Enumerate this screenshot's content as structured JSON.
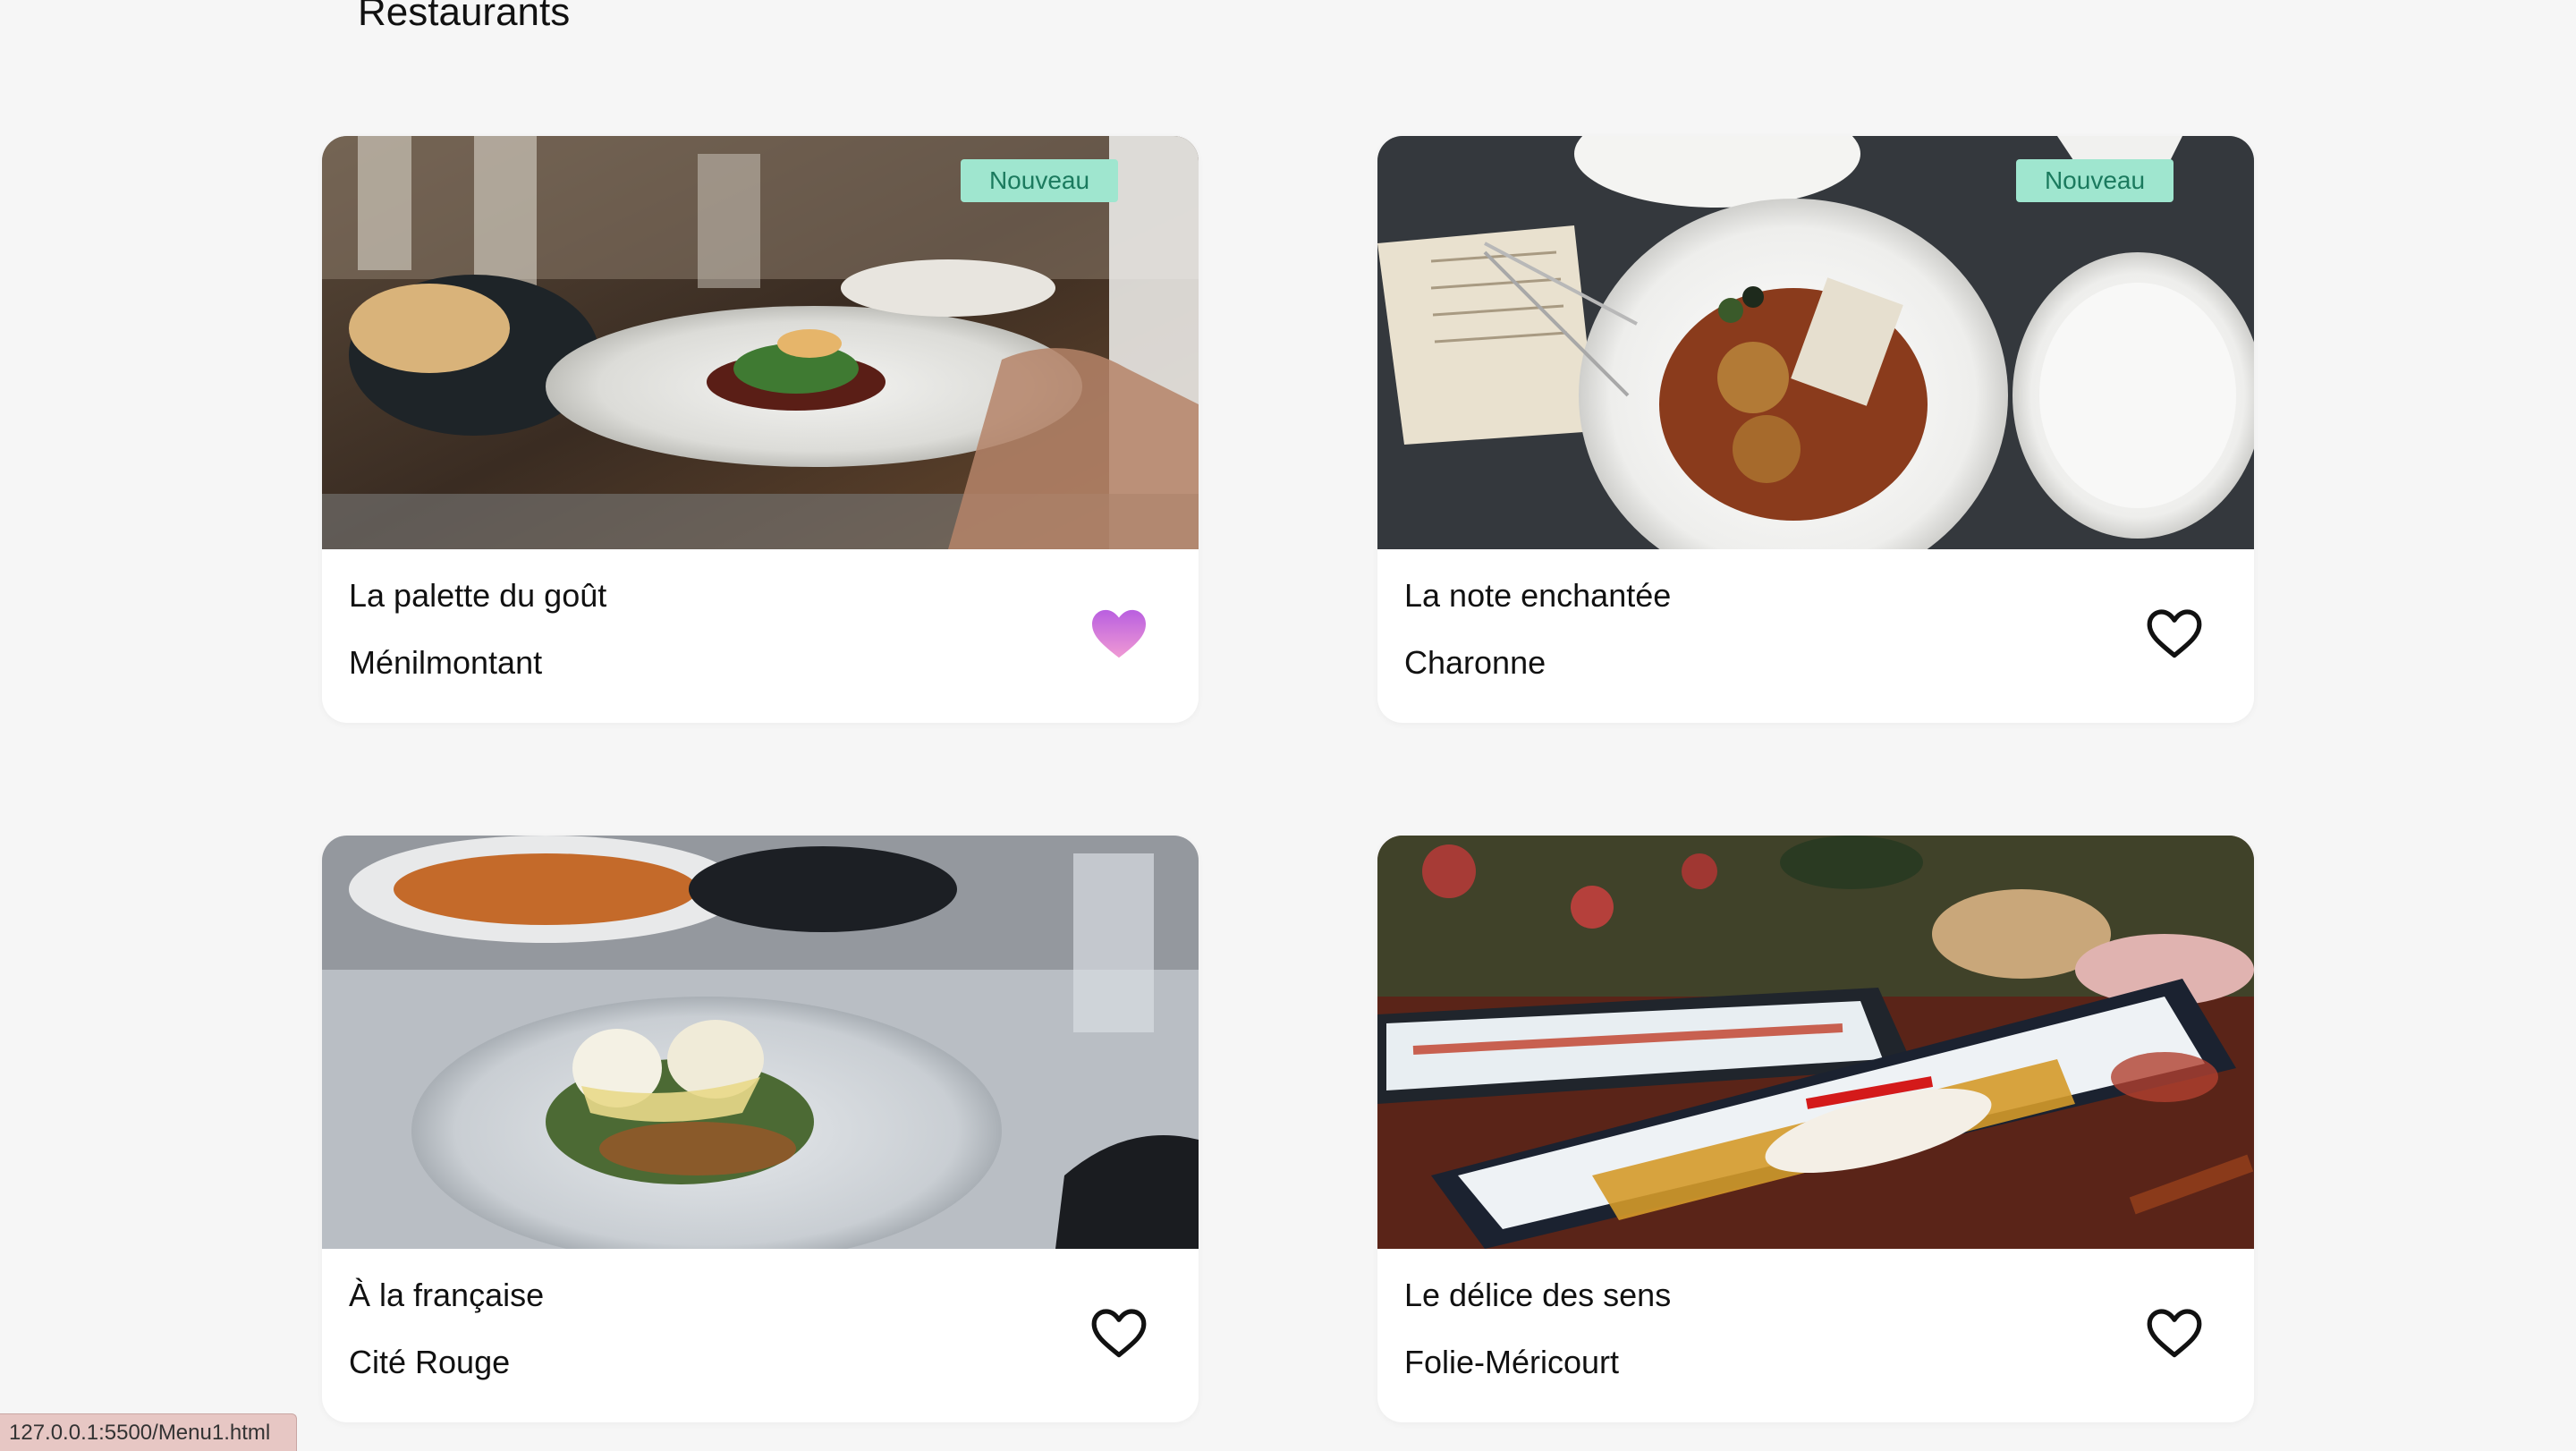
{
  "page": {
    "title": "Restaurants"
  },
  "restaurants": [
    {
      "name": "La palette du goût",
      "area": "Ménilmontant",
      "badge": "Nouveau",
      "favorite": true,
      "favorite_icon": "heart-filled-icon"
    },
    {
      "name": "La note enchantée",
      "area": "Charonne",
      "badge": "Nouveau",
      "favorite": false,
      "favorite_icon": "heart-outline-icon"
    },
    {
      "name": "À la française",
      "area": "Cité Rouge",
      "badge": "",
      "favorite": false,
      "favorite_icon": "heart-outline-icon"
    },
    {
      "name": "Le délice des sens",
      "area": "Folie-Méricourt",
      "badge": "",
      "favorite": false,
      "favorite_icon": "heart-outline-icon"
    }
  ],
  "status_bar": {
    "url": "127.0.0.1:5500/Menu1.html"
  },
  "colors": {
    "background": "#f6f6f6",
    "card": "#ffffff",
    "badge_bg": "#9fe6cf",
    "badge_text": "#1b7a5e",
    "heart_gradient_start": "#c96ee0",
    "heart_gradient_end": "#e893d8"
  }
}
